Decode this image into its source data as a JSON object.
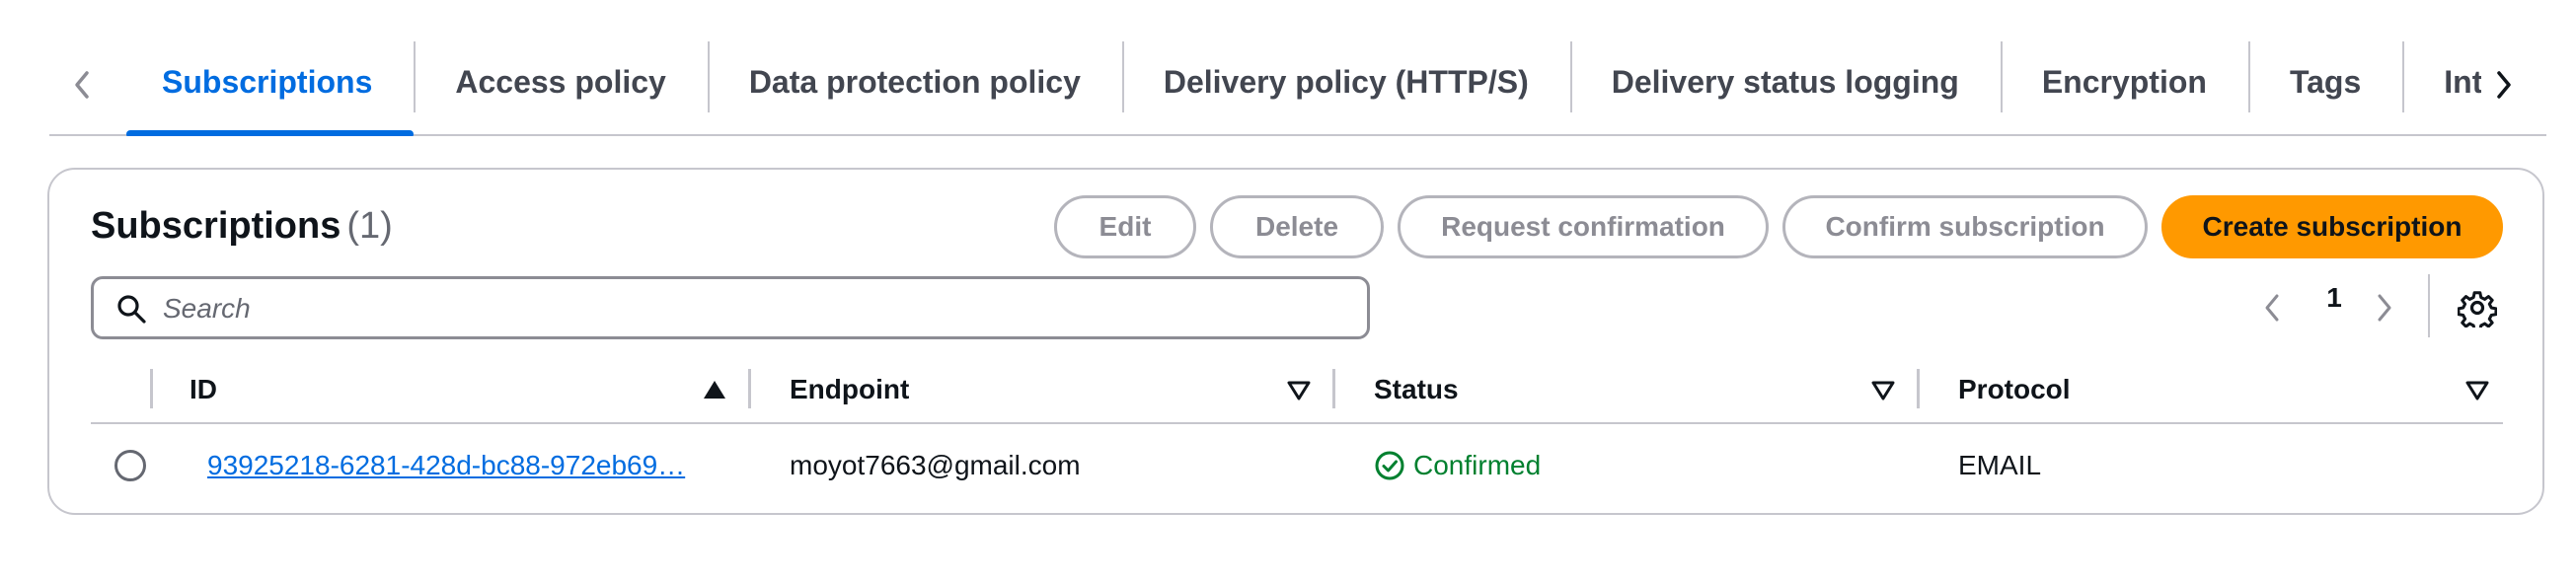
{
  "tabs": {
    "items": [
      {
        "label": "Subscriptions",
        "active": true
      },
      {
        "label": "Access policy"
      },
      {
        "label": "Data protection policy"
      },
      {
        "label": "Delivery policy (HTTP/S)"
      },
      {
        "label": "Delivery status logging"
      },
      {
        "label": "Encryption"
      },
      {
        "label": "Tags"
      },
      {
        "label": "Integrations"
      }
    ],
    "prev_icon": "chevron-left-icon",
    "next_icon": "chevron-right-icon"
  },
  "panel": {
    "title": "Subscriptions",
    "count": "(1)",
    "actions": {
      "edit": "Edit",
      "delete": "Delete",
      "request_confirmation": "Request confirmation",
      "confirm_subscription": "Confirm subscription",
      "create_subscription": "Create subscription"
    },
    "search": {
      "placeholder": "Search",
      "value": ""
    },
    "pagination": {
      "current_page": "1"
    }
  },
  "table": {
    "columns": [
      {
        "label": "ID",
        "sort": "ascending"
      },
      {
        "label": "Endpoint",
        "sort": "none"
      },
      {
        "label": "Status",
        "sort": "none"
      },
      {
        "label": "Protocol",
        "sort": "none"
      }
    ],
    "rows": [
      {
        "id": "93925218-6281-428d-bc88-972eb69…",
        "endpoint": "moyot7663@gmail.com",
        "status": "Confirmed",
        "protocol": "EMAIL",
        "selected": false
      }
    ]
  },
  "colors": {
    "accent": "#006ce0",
    "primary_button": "#ff9900",
    "success": "#00802f",
    "border": "#c6c6cd"
  }
}
